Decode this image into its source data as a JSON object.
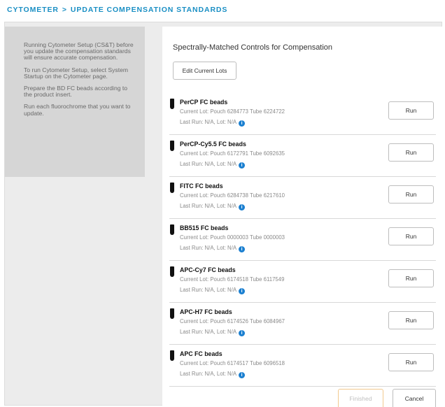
{
  "breadcrumb": {
    "root": "CYTOMETER",
    "separator": ">",
    "current": "UPDATE COMPENSATION STANDARDS"
  },
  "sidebar": {
    "paragraphs": [
      "Running Cytometer Setup (CS&T) before you update the compensation standards will ensure accurate compensation.",
      "To run Cytometer Setup, select System Startup on the Cytometer page.",
      "Prepare the BD FC beads according to the product insert.",
      "Run each fluorochrome that you want to update."
    ]
  },
  "main": {
    "title": "Spectrally-Matched Controls for Compensation",
    "edit_button": "Edit Current Lots",
    "run_label": "Run",
    "controls": [
      {
        "name": "PerCP FC beads",
        "lot": "Current Lot: Pouch 6284773 Tube 6224722",
        "last_run": "Last Run: N/A, Lot: N/A"
      },
      {
        "name": "PerCP-Cy5.5 FC beads",
        "lot": "Current Lot: Pouch 6172791 Tube 6092635",
        "last_run": "Last Run: N/A, Lot: N/A"
      },
      {
        "name": "FITC FC beads",
        "lot": "Current Lot: Pouch 6284738 Tube 6217610",
        "last_run": "Last Run: N/A, Lot: N/A"
      },
      {
        "name": "BB515 FC beads",
        "lot": "Current Lot: Pouch 0000003 Tube 0000003",
        "last_run": "Last Run: N/A, Lot: N/A"
      },
      {
        "name": "APC-Cy7 FC beads",
        "lot": "Current Lot: Pouch 6174518 Tube 6117549",
        "last_run": "Last Run: N/A, Lot: N/A"
      },
      {
        "name": "APC-H7 FC beads",
        "lot": "Current Lot: Pouch 6174526 Tube 6084967",
        "last_run": "Last Run: N/A, Lot: N/A"
      },
      {
        "name": "APC FC beads",
        "lot": "Current Lot: Pouch 6174517 Tube 6096518",
        "last_run": "Last Run: N/A, Lot: N/A"
      }
    ]
  },
  "footer": {
    "finished_label": "Finished",
    "cancel_label": "Cancel"
  },
  "colors": {
    "accent": "#1a8fc4",
    "info_icon": "#1a7fd0",
    "finished_border": "#f2c98e",
    "sidebar_bg": "#d6d6d6"
  },
  "icons": {
    "tube": "bead-tube-icon",
    "info": "info-icon"
  }
}
